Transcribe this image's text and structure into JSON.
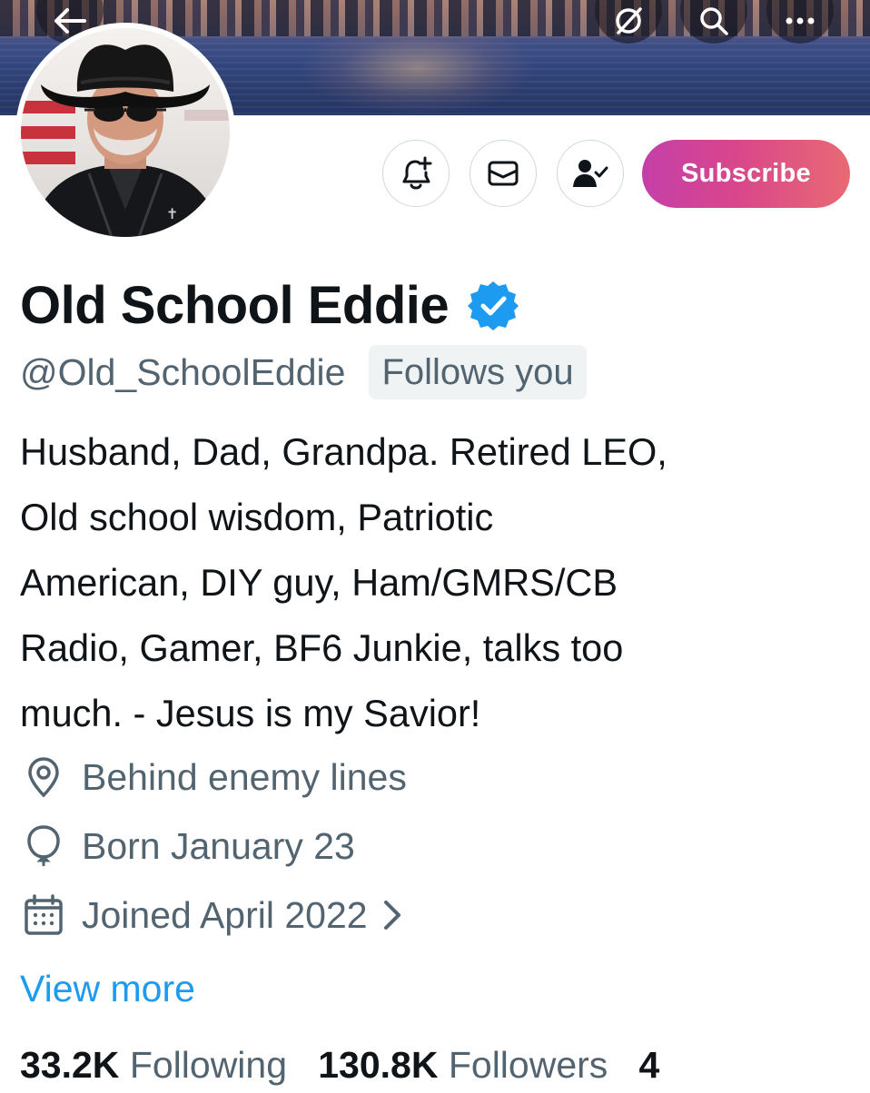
{
  "header": {
    "back_icon": "arrow-left-icon",
    "grok_icon": "grok-icon",
    "search_icon": "search-icon",
    "more_icon": "more-horizontal-icon"
  },
  "profile": {
    "name": "Old School Eddie",
    "verified": true,
    "handle": "@Old_SchoolEddie",
    "follows_you": "Follows you",
    "bio_lines": [
      "Husband, Dad, Grandpa. Retired LEO,",
      "Old school wisdom, Patriotic",
      "American, DIY guy, Ham/GMRS/CB",
      "Radio, Gamer, BF6 Junkie, talks too",
      "much. - Jesus is my Savior!"
    ],
    "location": "Behind enemy lines",
    "birthday": "Born January 23",
    "joined": "Joined April 2022",
    "view_more": "View more"
  },
  "actions": {
    "notify_icon": "bell-plus-icon",
    "message_icon": "envelope-icon",
    "following_icon": "person-check-icon",
    "subscribe_label": "Subscribe"
  },
  "stats": {
    "following_count": "33.2K",
    "following_label": "Following",
    "followers_count": "130.8K",
    "followers_label": "Followers",
    "extra_count": "4"
  },
  "colors": {
    "accent": "#1d9bf0",
    "subscribe_gradient_start": "#c43fa8",
    "subscribe_gradient_end": "#e86a73",
    "muted": "#536471",
    "text": "#0f1419"
  }
}
